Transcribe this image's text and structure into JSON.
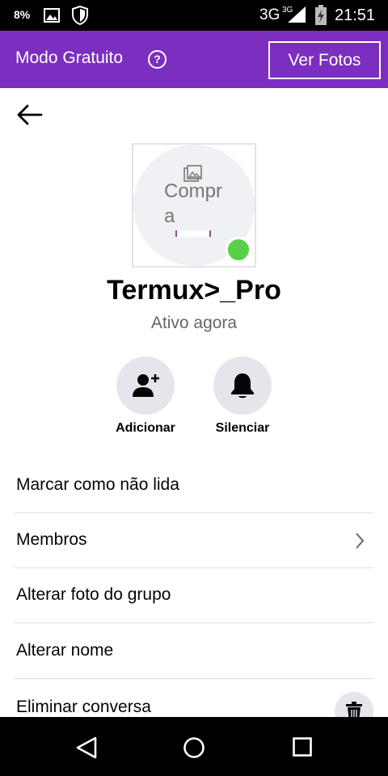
{
  "status_bar": {
    "battery_pct": "8%",
    "network": "3G",
    "network_sup": "3G",
    "time": "21:51"
  },
  "promo_bar": {
    "title": "Modo Gratuito",
    "help_icon": "?",
    "button_label": "Ver Fotos",
    "color": "#7b2ec0"
  },
  "profile": {
    "avatar_alt_text": "Compra",
    "name": "Termux>_Pro",
    "status": "Ativo agora",
    "online_color": "#56d046"
  },
  "actions": [
    {
      "label": "Adicionar",
      "icon": "add-person-icon"
    },
    {
      "label": "Silenciar",
      "icon": "bell-icon"
    }
  ],
  "menu": [
    {
      "label": "Marcar como não lida"
    },
    {
      "label": "Membros",
      "icon": "chevron-right-icon"
    },
    {
      "label": "Alterar foto do grupo"
    },
    {
      "label": "Alterar nome"
    },
    {
      "label": "Eliminar conversa",
      "icon": "trash-icon"
    }
  ]
}
